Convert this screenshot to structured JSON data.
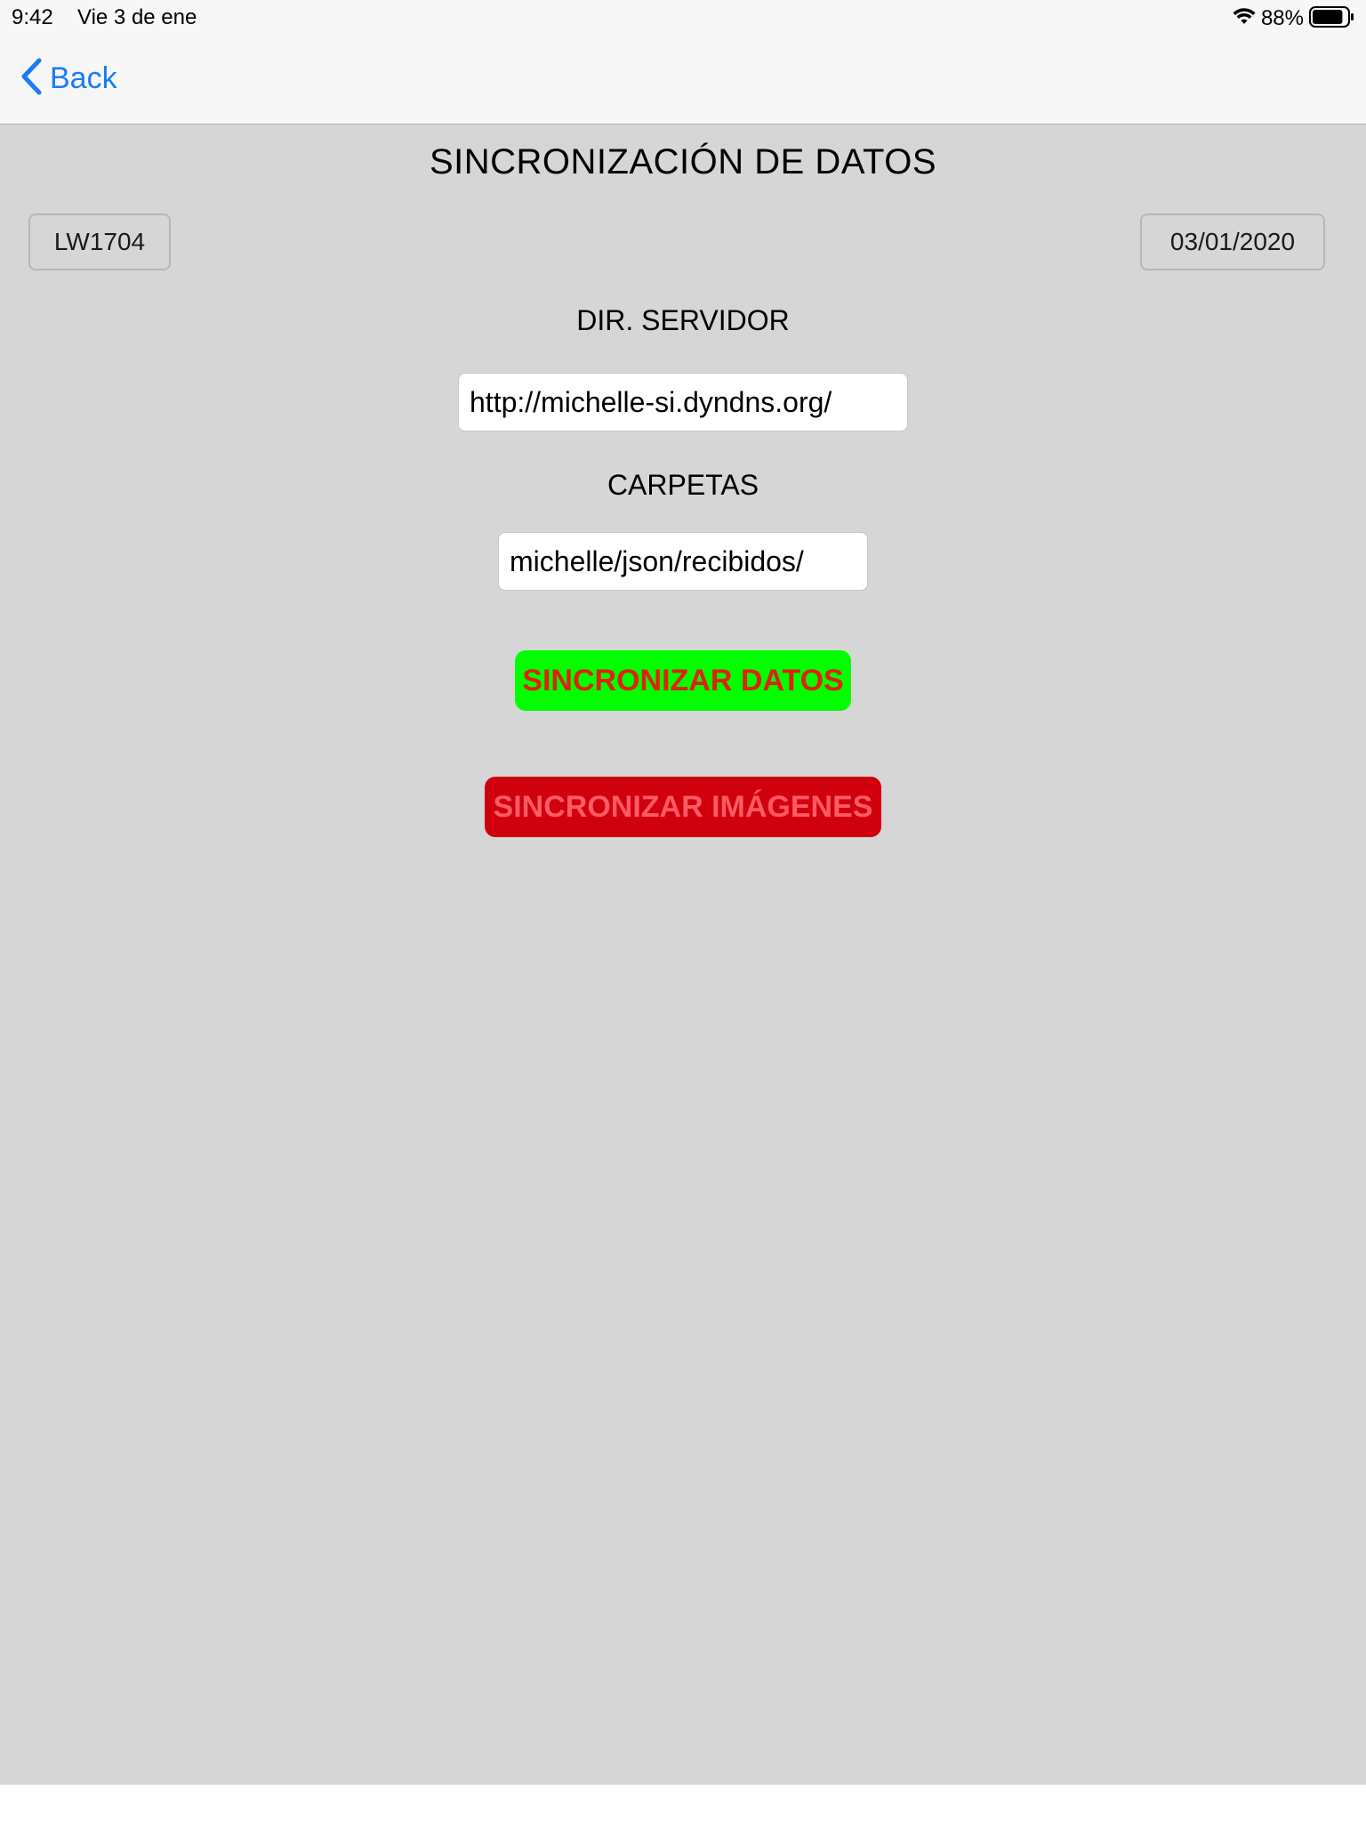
{
  "status_bar": {
    "time": "9:42",
    "date": "Vie 3 de ene",
    "battery_percent": "88%",
    "battery_level": 0.88,
    "icons": [
      "wifi-icon",
      "battery-icon"
    ]
  },
  "nav": {
    "back_label": "Back",
    "back_icon": "chevron-left-icon",
    "accent_color": "#1a7cf5"
  },
  "page": {
    "title": "SINCRONIZACIÓN DE DATOS",
    "device_code": "LW1704",
    "date": "03/01/2020",
    "server_label": "DIR. SERVIDOR",
    "server_value": "http://michelle-si.dyndns.org/",
    "folders_label": "CARPETAS",
    "folders_value": "michelle/json/recibidos/",
    "background_color": "#d6d6d6"
  },
  "actions": {
    "sync_data_label": "SINCRONIZAR DATOS",
    "sync_data_colors": {
      "background": "#00ff00",
      "text": "#e0220d"
    },
    "sync_images_label": "SINCRONIZAR IMÁGENES",
    "sync_images_colors": {
      "background": "#d0000d",
      "text": "#ff5a66"
    }
  }
}
